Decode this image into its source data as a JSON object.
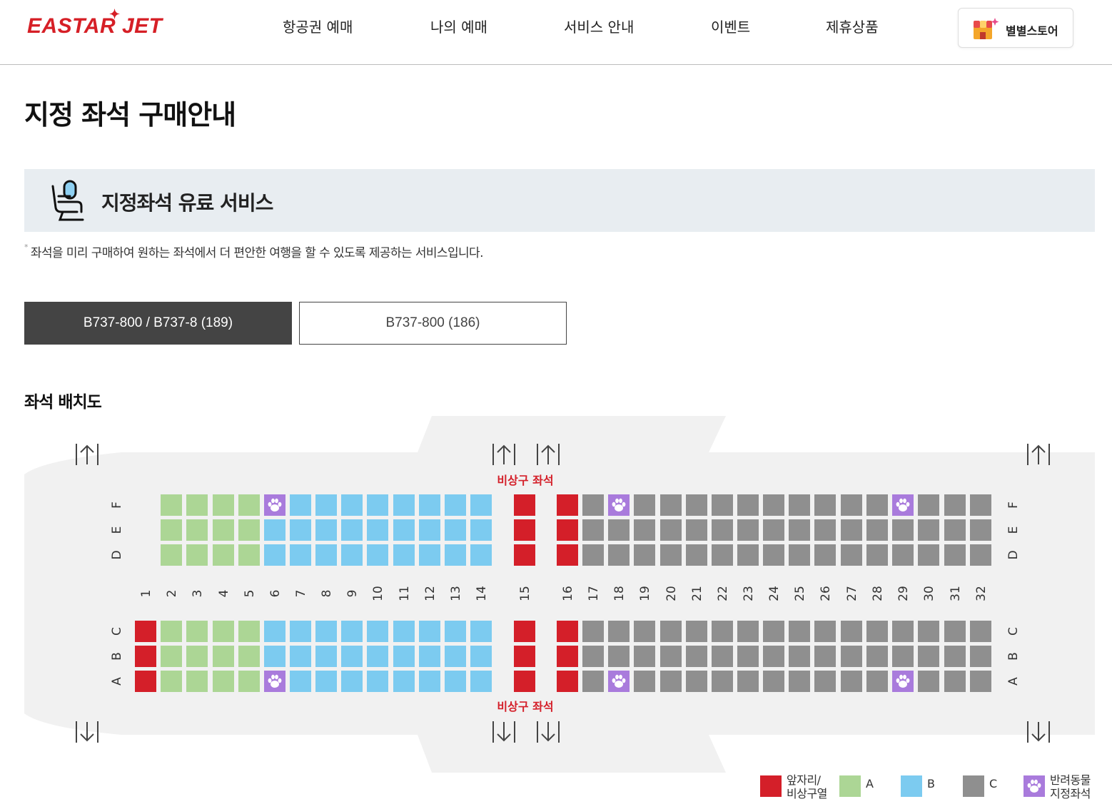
{
  "header": {
    "logo": "EASTAR JET",
    "nav": [
      {
        "label": "항공권 예매"
      },
      {
        "label": "나의 예매"
      },
      {
        "label": "서비스 안내"
      },
      {
        "label": "이벤트"
      },
      {
        "label": "제휴상품"
      }
    ],
    "store_label": "별별스토어"
  },
  "page_title": "지정 좌석 구매안내",
  "banner": {
    "icon": "seat-icon",
    "title": "지정좌석 유료 서비스"
  },
  "note": "좌석을 미리 구매하여 원하는 좌석에서 더 편안한 여행을 할 수 있도록 제공하는 서비스입니다.",
  "tabs": [
    {
      "label": "B737-800 / B737-8 (189)",
      "active": true
    },
    {
      "label": "B737-800 (186)",
      "active": false
    }
  ],
  "seatmap": {
    "section_title": "좌석 배치도",
    "exit_label_top": "비상구 좌석",
    "exit_label_bottom": "비상구 좌석",
    "upper_letters": [
      "D",
      "E",
      "F"
    ],
    "lower_letters": [
      "A",
      "B",
      "C"
    ],
    "rows": [
      "1",
      "2",
      "3",
      "4",
      "5",
      "6",
      "7",
      "8",
      "9",
      "10",
      "11",
      "12",
      "13",
      "14",
      "15",
      "16",
      "17",
      "18",
      "19",
      "20",
      "21",
      "22",
      "23",
      "24",
      "25",
      "26",
      "27",
      "28",
      "29",
      "30",
      "31",
      "32"
    ],
    "row1_upper_seats": false,
    "row_category": {
      "1": "front",
      "2": "A",
      "3": "A",
      "4": "A",
      "5": "A",
      "6": "B",
      "7": "B",
      "8": "B",
      "9": "B",
      "10": "B",
      "11": "B",
      "12": "B",
      "13": "B",
      "14": "B",
      "15": "front",
      "16": "front",
      "17": "C",
      "18": "C",
      "19": "C",
      "20": "C",
      "21": "C",
      "22": "C",
      "23": "C",
      "24": "C",
      "25": "C",
      "26": "C",
      "27": "C",
      "28": "C",
      "29": "C",
      "30": "C",
      "31": "C",
      "32": "C"
    },
    "pet_seats": [
      "6F",
      "18F",
      "29F",
      "6A",
      "18A",
      "29A"
    ],
    "colors": {
      "front": "#d41f29",
      "A": "#acd695",
      "B": "#7ccbf0",
      "C": "#8f8f8f",
      "pet": "#a97bdc"
    }
  },
  "legend": [
    {
      "key": "front",
      "label_line1": "앞자리/",
      "label_line2": "비상구열"
    },
    {
      "key": "A",
      "label_line1": "A",
      "label_line2": ""
    },
    {
      "key": "B",
      "label_line1": "B",
      "label_line2": ""
    },
    {
      "key": "C",
      "label_line1": "C",
      "label_line2": ""
    },
    {
      "key": "pet",
      "label_line1": "반려동물",
      "label_line2": "지정좌석"
    }
  ]
}
